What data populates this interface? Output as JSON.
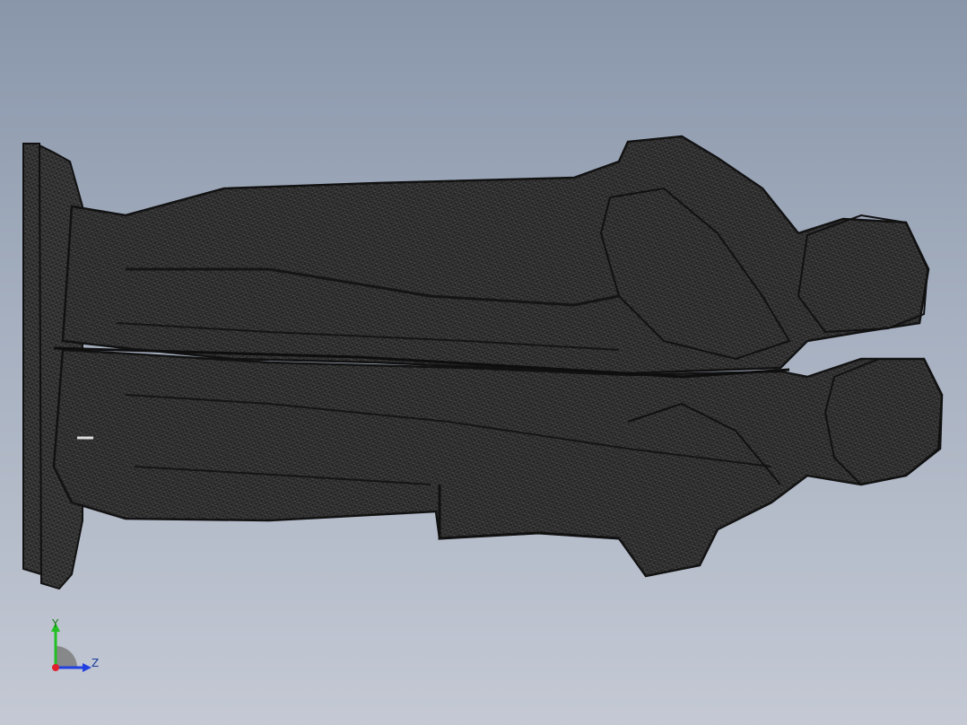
{
  "viewport": {
    "background_top": "#8996aa",
    "background_bottom": "#c4c9d4",
    "model": {
      "icon": "wireframe-statue-mesh",
      "fill_color": "#3a3a3a",
      "mesh_color": "#1a1a1a"
    }
  },
  "triad": {
    "y_label": "Y",
    "z_label": "Z",
    "x_color": "#e0202a",
    "y_color": "#22c022",
    "z_color": "#2040e0"
  }
}
